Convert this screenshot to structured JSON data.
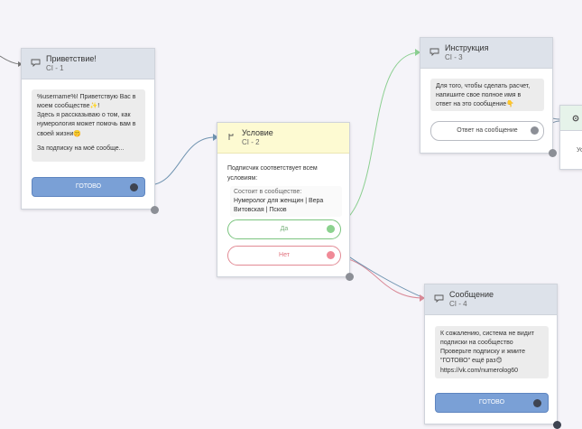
{
  "nodes": {
    "greeting": {
      "title": "Приветствие!",
      "id": "CI - 1",
      "message_lines": [
        "%username%! Приветствую Вас в",
        "моем сообществе✨!",
        "Здесь я рассказываю о том, как",
        "нумерология может помочь вам в",
        "своей жизни🤫",
        "",
        "За подписку на моё сообще..."
      ],
      "button_label": "ГОТОВО"
    },
    "condition": {
      "title": "Условие",
      "id": "CI - 2",
      "description_lines": [
        "Подписчик соответствует всем",
        "условиям:"
      ],
      "rule_lines": [
        "Состоит в сообществе:",
        "Нумеролог для женщин | Вера",
        "Витовская | Псков"
      ],
      "yes_label": "Да",
      "no_label": "Нет"
    },
    "instruction": {
      "title": "Инструкция",
      "id": "CI - 3",
      "message_lines": [
        "Для того, чтобы сделать расчет,",
        "напишите свое полное имя в",
        "ответ на это сообщение👇"
      ],
      "reply_label": "Ответ на сообщение"
    },
    "message": {
      "title": "Сообщение",
      "id": "CI - 4",
      "message_lines": [
        "К сожалению, система не видит",
        "подписки на сообщество",
        "Проверьте подписку и жмите",
        "\"ГОТОВО\" ещё раз😊",
        "https://vk.com/numerolog60"
      ],
      "button_label": "ГОТОВО"
    },
    "partial": {
      "text": "Ус"
    }
  },
  "colors": {
    "canvas": "#f5f4f9",
    "header": "#dde2ea",
    "condition_header": "#fdfad2",
    "button_blue": "#7aa0d6",
    "yes_green": "#7bc47f",
    "no_pink": "#e28b95",
    "wire_blue": "#6f93b0",
    "wire_green": "#8ccf91",
    "wire_pink": "#d98a98"
  }
}
